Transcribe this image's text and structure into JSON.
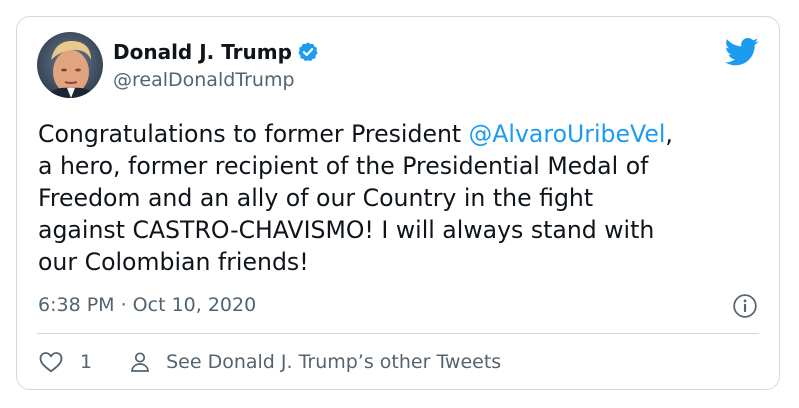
{
  "tweet": {
    "author": {
      "display_name": "Donald J. Trump",
      "handle": "@realDonaldTrump",
      "verified": true,
      "avatar_icon": "profile-photo"
    },
    "text_lines": [
      {
        "before": "Congratulations to former President ",
        "mention": "@AlvaroUribeVel",
        "after": ","
      },
      {
        "text": "a hero, former recipient of the Presidential Medal of"
      },
      {
        "text": "Freedom and an ally of our Country in the fight"
      },
      {
        "text": "against CASTRO-CHAVISMO! I will always stand with"
      },
      {
        "text": "our Colombian friends!"
      }
    ],
    "timestamp": "6:38 PM · Oct 10, 2020",
    "likes": "1",
    "other_tweets_label": "See Donald J. Trump’s other Tweets"
  },
  "icons": {
    "brand": "twitter-bird-icon",
    "verified": "verified-badge-icon",
    "info": "info-icon",
    "like": "heart-icon",
    "profile": "person-icon"
  },
  "colors": {
    "brand_blue": "#1d9bf0",
    "text": "#0f1419",
    "secondary_text": "#536471",
    "border": "#cfd9de"
  }
}
